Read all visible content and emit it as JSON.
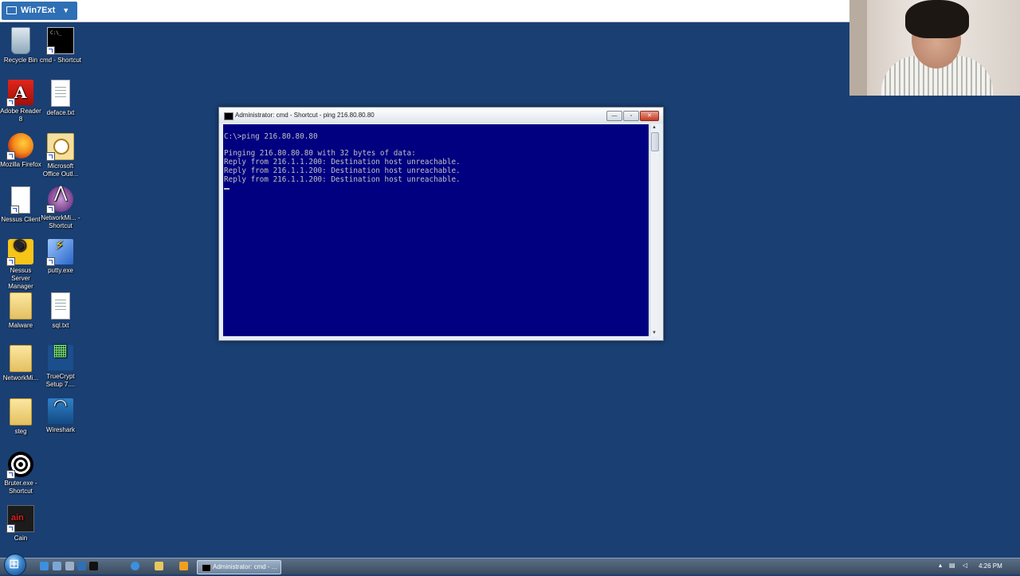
{
  "vm_tab": {
    "label": "Win7Ext"
  },
  "desktop": {
    "icons": [
      {
        "label": "Recycle Bin"
      },
      {
        "label": "cmd - Shortcut"
      },
      {
        "label": "Adobe Reader 8"
      },
      {
        "label": "deface.txt"
      },
      {
        "label": "Mozilla Firefox"
      },
      {
        "label": "Microsoft Office Outl..."
      },
      {
        "label": "Nessus Client"
      },
      {
        "label": "NetworkMi... - Shortcut"
      },
      {
        "label": "Nessus Server Manager"
      },
      {
        "label": "putty.exe"
      },
      {
        "label": "Malware"
      },
      {
        "label": "sql.txt"
      },
      {
        "label": "NetworkMi..."
      },
      {
        "label": "TrueCrypt Setup 7...."
      },
      {
        "label": "steg"
      },
      {
        "label": "Wireshark"
      },
      {
        "label": "Bruter.exe - Shortcut"
      },
      {
        "label": "Cain"
      }
    ]
  },
  "cmd_window": {
    "title": "Administrator: cmd - Shortcut - ping  216.80.80.80",
    "buttons": {
      "minimize": "—",
      "maximize": "▫",
      "close": "✕"
    },
    "lines": {
      "command": "C:\\>ping 216.80.80.80",
      "pinging": "Pinging 216.80.80.80 with 32 bytes of data:",
      "reply1": "Reply from 216.1.1.200: Destination host unreachable.",
      "reply2": "Reply from 216.1.1.200: Destination host unreachable.",
      "reply3": "Reply from 216.1.1.200: Destination host unreachable."
    }
  },
  "taskbar": {
    "active_task": "Administrator: cmd - ...",
    "clock": "4:26 PM"
  },
  "colors": {
    "desktop_bg": "#1a3f73",
    "console_bg": "#000080",
    "console_text": "#c0c0c0",
    "vm_tab": "#2f6fb5"
  }
}
